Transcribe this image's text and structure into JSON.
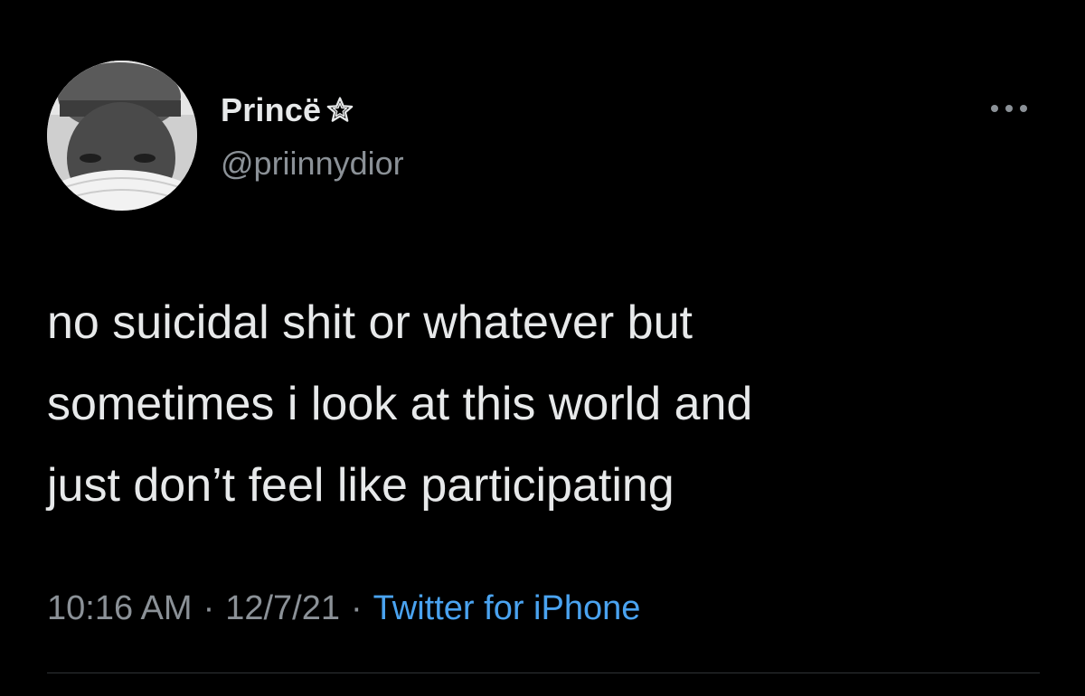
{
  "user": {
    "display_name": "Princë",
    "badge_icon": "star-outline-icon",
    "handle": "@priinnydior",
    "avatar": "profile-photo"
  },
  "tweet": {
    "text": "no suicidal shit or whatever but\nsometimes i look at this world and\njust don’t feel like participating",
    "time": "10:16 AM",
    "date": "12/7/21",
    "separator": "·",
    "source": "Twitter for iPhone"
  },
  "colors": {
    "background": "#000000",
    "primary_text": "#e7e9ea",
    "secondary_text": "#8b9197",
    "link": "#4aa3f0",
    "divider": "#2f3336"
  },
  "icons": {
    "more": "more-horizontal-icon"
  }
}
